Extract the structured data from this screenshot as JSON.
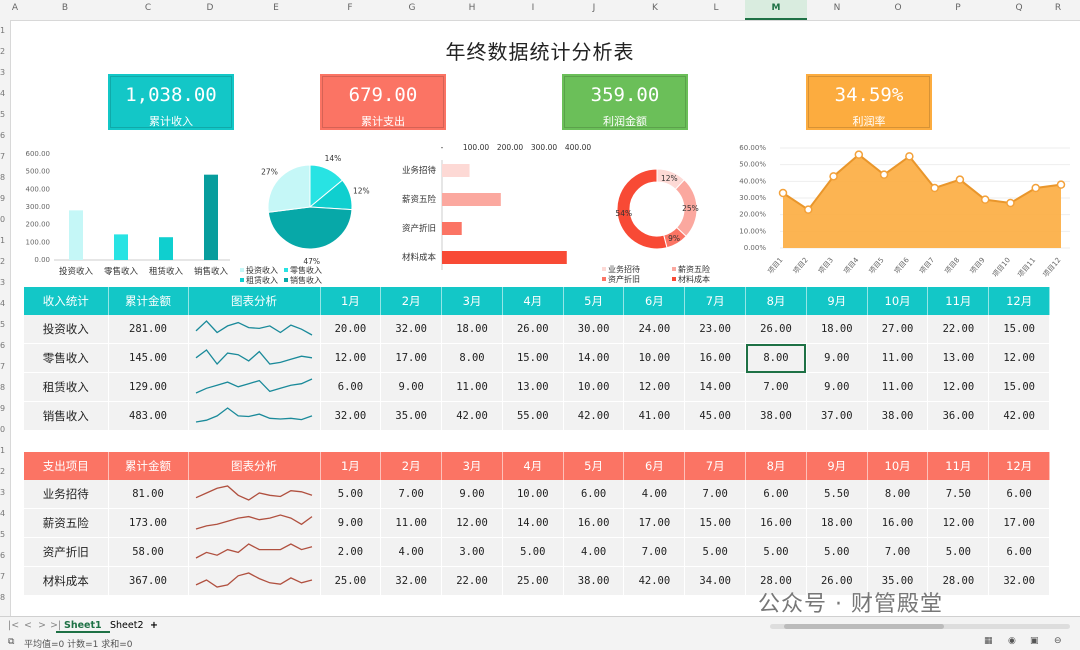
{
  "columns": [
    "A",
    "B",
    "C",
    "D",
    "E",
    "F",
    "G",
    "H",
    "I",
    "J",
    "K",
    "L",
    "M",
    "N",
    "O",
    "P",
    "Q",
    "R"
  ],
  "rows": [
    "1",
    "2",
    "3",
    "4",
    "5",
    "6",
    "7",
    "8",
    "9",
    "0",
    "1",
    "2",
    "3",
    "4",
    "5",
    "6",
    "7",
    "8",
    "9",
    "0",
    "1",
    "2",
    "3",
    "4",
    "5",
    "6",
    "7",
    "8"
  ],
  "title": "年终数据统计分析表",
  "kpis": [
    {
      "value": "1,038.00",
      "label": "累计收入",
      "color": "#13c7c7"
    },
    {
      "value": "679.00",
      "label": "累计支出",
      "color": "#fb7464"
    },
    {
      "value": "359.00",
      "label": "利润金额",
      "color": "#6bbf59"
    },
    {
      "value": "34.59%",
      "label": "利润率",
      "color": "#fcac3f"
    }
  ],
  "chart_data": [
    {
      "type": "bar",
      "categories": [
        "投资收入",
        "零售收入",
        "租赁收入",
        "销售收入"
      ],
      "values": [
        281,
        145,
        129,
        483
      ],
      "ylim": [
        0,
        600
      ],
      "yticks": [
        "0.00",
        "100.00",
        "200.00",
        "300.00",
        "400.00",
        "500.00",
        "600.00"
      ],
      "colors": [
        "#c5f7f7",
        "#28e3e3",
        "#0fcfcf",
        "#079d9d"
      ]
    },
    {
      "type": "pie",
      "slices": [
        {
          "name": "投资收入",
          "value": 27,
          "label": "27%",
          "color": "#c5f7f7"
        },
        {
          "name": "零售收入",
          "value": 14,
          "label": "14%",
          "color": "#28e3e3"
        },
        {
          "name": "租赁收入",
          "value": 12,
          "label": "12%",
          "color": "#0fcfcf"
        },
        {
          "name": "销售收入",
          "value": 47,
          "label": "47%",
          "color": "#07a8a8"
        }
      ],
      "legend": [
        "投资收入",
        "零售收入",
        "租赁收入",
        "销售收入"
      ]
    },
    {
      "type": "bar",
      "orientation": "horizontal",
      "categories": [
        "业务招待",
        "薪资五险",
        "资产折旧",
        "材料成本"
      ],
      "values": [
        81,
        173,
        58,
        367
      ],
      "xlim": [
        0,
        400
      ],
      "xticks": [
        "-",
        "100.00",
        "200.00",
        "300.00",
        "400.00"
      ],
      "colors": [
        "#fdd9d5",
        "#fba89f",
        "#fb7464",
        "#f84a35"
      ]
    },
    {
      "type": "pie",
      "donut": true,
      "slices": [
        {
          "name": "业务招待",
          "value": 12,
          "label": "12%",
          "color": "#fdd9d5"
        },
        {
          "name": "薪资五险",
          "value": 25,
          "label": "25%",
          "color": "#fba89f"
        },
        {
          "name": "资产折旧",
          "value": 9,
          "label": "9%",
          "color": "#fb7464"
        },
        {
          "name": "材料成本",
          "value": 54,
          "label": "54%",
          "color": "#f84a35"
        }
      ],
      "legend": [
        "业务招待",
        "薪资五险",
        "资产折旧",
        "材料成本"
      ]
    },
    {
      "type": "area",
      "categories": [
        "项目1",
        "项目2",
        "项目3",
        "项目4",
        "项目5",
        "项目6",
        "项目7",
        "项目8",
        "项目9",
        "项目10",
        "项目11",
        "项目12"
      ],
      "values": [
        33,
        23,
        43,
        56,
        44,
        55,
        36,
        41,
        29,
        27,
        36,
        38
      ],
      "ylim": [
        0,
        60
      ],
      "yticks": [
        "0.00%",
        "10.00%",
        "20.00%",
        "30.00%",
        "40.00%",
        "50.00%",
        "60.00%"
      ],
      "color": "#fcac3f"
    }
  ],
  "income": {
    "headers": [
      "收入统计",
      "累计金额",
      "图表分析",
      "1月",
      "2月",
      "3月",
      "4月",
      "5月",
      "6月",
      "7月",
      "8月",
      "9月",
      "10月",
      "11月",
      "12月"
    ],
    "color": "#13c7c7",
    "spark": "#1a8a9a",
    "rows": [
      {
        "name": "投资收入",
        "total": "281.00",
        "months": [
          "20.00",
          "32.00",
          "18.00",
          "26.00",
          "30.00",
          "24.00",
          "23.00",
          "26.00",
          "18.00",
          "27.00",
          "22.00",
          "15.00"
        ]
      },
      {
        "name": "零售收入",
        "total": "145.00",
        "months": [
          "12.00",
          "17.00",
          "8.00",
          "15.00",
          "14.00",
          "10.00",
          "16.00",
          "8.00",
          "9.00",
          "11.00",
          "13.00",
          "12.00"
        ]
      },
      {
        "name": "租赁收入",
        "total": "129.00",
        "months": [
          "6.00",
          "9.00",
          "11.00",
          "13.00",
          "10.00",
          "12.00",
          "14.00",
          "7.00",
          "9.00",
          "11.00",
          "12.00",
          "15.00"
        ]
      },
      {
        "name": "销售收入",
        "total": "483.00",
        "months": [
          "32.00",
          "35.00",
          "42.00",
          "55.00",
          "42.00",
          "41.00",
          "45.00",
          "38.00",
          "37.00",
          "38.00",
          "36.00",
          "42.00"
        ]
      }
    ]
  },
  "expense": {
    "headers": [
      "支出项目",
      "累计金额",
      "图表分析",
      "1月",
      "2月",
      "3月",
      "4月",
      "5月",
      "6月",
      "7月",
      "8月",
      "9月",
      "10月",
      "11月",
      "12月"
    ],
    "color": "#fb7464",
    "spark": "#b0503f",
    "rows": [
      {
        "name": "业务招待",
        "total": "81.00",
        "months": [
          "5.00",
          "7.00",
          "9.00",
          "10.00",
          "6.00",
          "4.00",
          "7.00",
          "6.00",
          "5.50",
          "8.00",
          "7.50",
          "6.00"
        ]
      },
      {
        "name": "薪资五险",
        "total": "173.00",
        "months": [
          "9.00",
          "11.00",
          "12.00",
          "14.00",
          "16.00",
          "17.00",
          "15.00",
          "16.00",
          "18.00",
          "16.00",
          "12.00",
          "17.00"
        ]
      },
      {
        "name": "资产折旧",
        "total": "58.00",
        "months": [
          "2.00",
          "4.00",
          "3.00",
          "5.00",
          "4.00",
          "7.00",
          "5.00",
          "5.00",
          "5.00",
          "7.00",
          "5.00",
          "6.00"
        ]
      },
      {
        "name": "材料成本",
        "total": "367.00",
        "months": [
          "25.00",
          "32.00",
          "22.00",
          "25.00",
          "38.00",
          "42.00",
          "34.00",
          "28.00",
          "26.00",
          "35.00",
          "28.00",
          "32.00"
        ]
      }
    ]
  },
  "tabs": {
    "sheet1": "Sheet1",
    "sheet2": "Sheet2",
    "add": "+"
  },
  "watermark": "公众号 · 财管殿堂",
  "status": {
    "label": "平均值=0 计数=1 求和=0"
  }
}
